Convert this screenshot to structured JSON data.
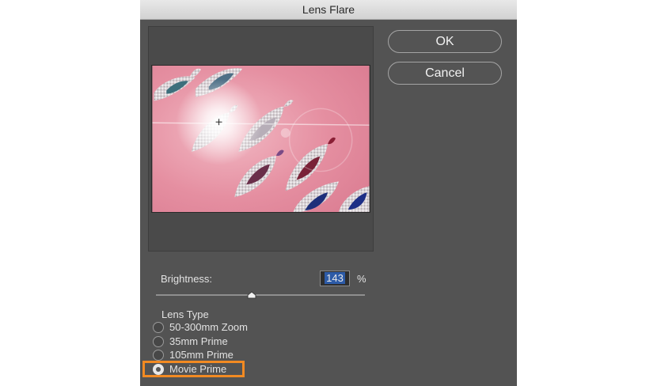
{
  "dialog": {
    "title": "Lens Flare",
    "ok_label": "OK",
    "cancel_label": "Cancel"
  },
  "brightness": {
    "label": "Brightness:",
    "value": "143",
    "unit": "%",
    "slider_position": 0.46
  },
  "lens_type": {
    "label": "Lens Type",
    "options": [
      {
        "label": "50-300mm Zoom",
        "selected": false
      },
      {
        "label": "35mm Prime",
        "selected": false
      },
      {
        "label": "105mm Prime",
        "selected": false
      },
      {
        "label": "Movie Prime",
        "selected": true
      }
    ]
  },
  "colors": {
    "dialog_background": "#535353",
    "highlight": "#f28a22",
    "preview_pink": "#e4889a"
  },
  "icons": {
    "flare_center": "crosshair-icon"
  }
}
